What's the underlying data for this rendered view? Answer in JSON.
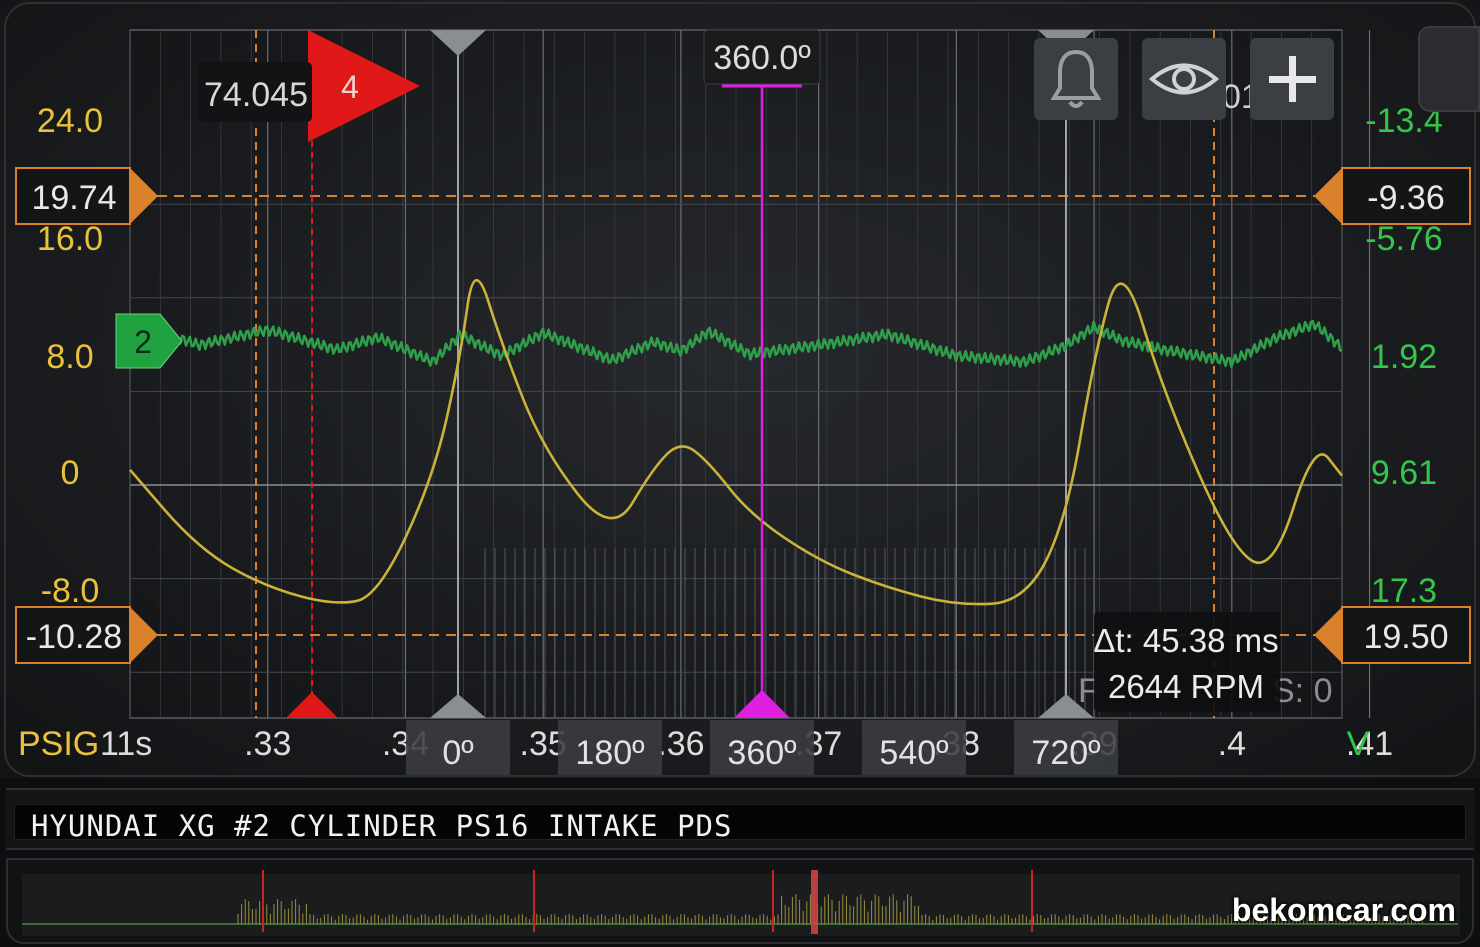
{
  "chart_data": {
    "type": "line",
    "title": "HYUNDAI XG #2 CYLINDER PS16 INTAKE PDS",
    "x": [
      0.32,
      0.325,
      0.33,
      0.335,
      0.338,
      0.342,
      0.344,
      0.345,
      0.347,
      0.35,
      0.355,
      0.358,
      0.36,
      0.362,
      0.365,
      0.37,
      0.375,
      0.38,
      0.385,
      0.388,
      0.39,
      0.392,
      0.395,
      0.4,
      0.403,
      0.406,
      0.408
    ],
    "xlabel": "11s",
    "xticks": [
      ".33",
      ".34",
      ".35",
      ".36",
      ".37",
      ".38",
      ".39",
      ".4",
      ".41"
    ],
    "xlim": [
      0.32,
      0.408
    ],
    "series": [
      {
        "name": "PSIG",
        "color": "#c9b33a",
        "axis": "left",
        "values": [
          1.3,
          -5.5,
          -8.8,
          -10.3,
          -9.5,
          0.5,
          11.0,
          19.5,
          12.0,
          3.0,
          -4.5,
          1.5,
          3.8,
          2.0,
          -2.5,
          -6.5,
          -8.8,
          -10.3,
          -10.0,
          -3.0,
          11.0,
          19.7,
          8.0,
          -5.5,
          -7.5,
          3.8,
          0.8
        ]
      },
      {
        "name": "2",
        "color": "#2f9e4a",
        "axis": "right",
        "values": [
          -0.4,
          1.2,
          0.2,
          1.5,
          0.7,
          2.3,
          0.5,
          1.0,
          1.9,
          0.4,
          2.2,
          1.0,
          1.6,
          0.3,
          1.8,
          1.2,
          0.5,
          1.9,
          2.3,
          1.2,
          0.0,
          0.9,
          1.5,
          2.3,
          0.8,
          -0.2,
          1.4
        ]
      }
    ],
    "left_axis": {
      "ticks": [
        "24.0",
        "16.0",
        "8.0",
        "0",
        "-8.0"
      ],
      "ylim": [
        -16,
        24
      ],
      "unit": "PSIG"
    },
    "right_axis": {
      "ticks": [
        "-13.4",
        "-5.76",
        "1.92",
        "9.61",
        "17.3"
      ],
      "unit": "V"
    },
    "cursor_left_values": [
      "19.74",
      "-10.28"
    ],
    "cursor_right_values": [
      "-9.36",
      "19.50"
    ],
    "marker_readout": "74.045",
    "marker_number": "4",
    "channel_badge": "2",
    "cursor_angle": "360.0º",
    "degree_labels": [
      "0º",
      "180º",
      "360º",
      "540º",
      "720º"
    ],
    "partial_overlay_text": [
      "01",
      "F",
      "S: 0"
    ],
    "grid": true
  },
  "measurement": {
    "delta_t": "Δt: 45.38 ms",
    "rpm": "2644 RPM"
  },
  "toolbar": {
    "bell_icon": "bell-icon",
    "eye_icon": "eye-icon",
    "plus_icon": "plus-icon"
  },
  "waveform_title": "HYUNDAI XG #2 CYLINDER PS16 INTAKE PDS",
  "watermark": "bekomcar.com",
  "colors": {
    "trace_yellow": "#c9b33a",
    "trace_green": "#2f9e4a",
    "cursor_orange": "#d9822b",
    "cursor_magenta": "#e020e0",
    "marker_red": "#e01818",
    "axis_yellow": "#e8c23a",
    "axis_green": "#33c64a"
  }
}
